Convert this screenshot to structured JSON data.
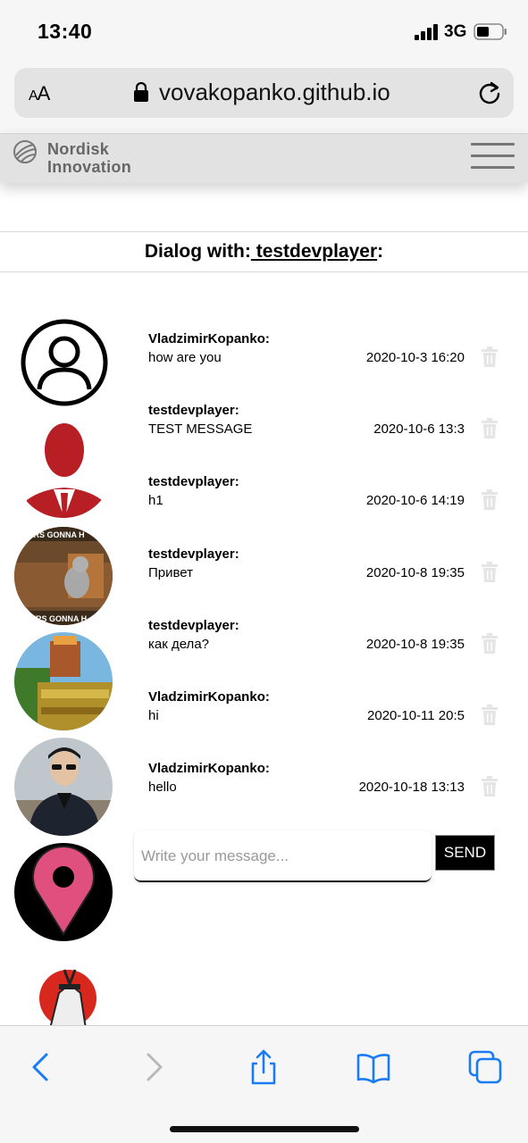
{
  "status_bar": {
    "time": "13:40",
    "network": "3G"
  },
  "browser": {
    "text_size_label": "AA",
    "url": "vovakopanko.github.io"
  },
  "site": {
    "logo_line1": "Nordisk",
    "logo_line2": "Innovation"
  },
  "dialog": {
    "prefix": "Dialog with:",
    "username": " testdevplayer",
    "suffix": ":"
  },
  "messages": [
    {
      "author": "VladzimirKopanko:",
      "text": "how are you",
      "date": "2020-10-3 16:20"
    },
    {
      "author": "testdevplayer:",
      "text": "TEST MESSAGE",
      "date": "2020-10-6 13:3"
    },
    {
      "author": "testdevplayer:",
      "text": "h1",
      "date": "2020-10-6 14:19"
    },
    {
      "author": "testdevplayer:",
      "text": "Привет",
      "date": "2020-10-8 19:35"
    },
    {
      "author": "testdevplayer:",
      "text": "как дела?",
      "date": "2020-10-8 19:35"
    },
    {
      "author": "VladzimirKopanko:",
      "text": "hi",
      "date": "2020-10-11 20:5"
    },
    {
      "author": "VladzimirKopanko:",
      "text": "hello",
      "date": "2020-10-18 13:13"
    }
  ],
  "composer": {
    "placeholder": "Write your message...",
    "send_label": "SEND"
  },
  "avatars": [
    {
      "icon": "default-user-icon"
    },
    {
      "icon": "red-silhouette-avatar"
    },
    {
      "icon": "cat-meme-avatar",
      "caption": "TERS GONNA H"
    },
    {
      "icon": "game-scene-avatar"
    },
    {
      "icon": "person-photo-avatar"
    },
    {
      "icon": "location-pin-avatar"
    },
    {
      "icon": "samurai-avatar"
    }
  ],
  "colors": {
    "accent": "#1a7cf5",
    "pin": "#e0507e",
    "silhouette": "#b81f24"
  }
}
